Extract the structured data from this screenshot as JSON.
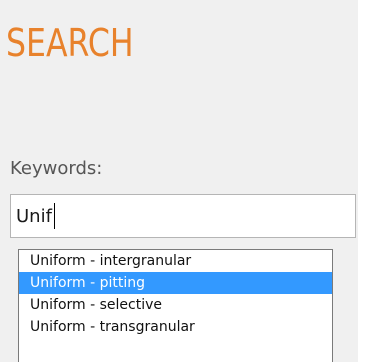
{
  "search": {
    "title": "SEARCH",
    "keywords_label": "Keywords:",
    "input_value": "Unif",
    "suggestions": [
      {
        "label": "Uniform - intergranular",
        "selected": false
      },
      {
        "label": "Uniform - pitting",
        "selected": true
      },
      {
        "label": "Uniform - selective",
        "selected": false
      },
      {
        "label": "Uniform - transgranular",
        "selected": false
      }
    ]
  },
  "colors": {
    "title": "#e8822c",
    "panel_bg": "#f0f0f0",
    "label_text": "#555555",
    "selection_bg": "#3399ff",
    "selection_text": "#ffffff"
  }
}
